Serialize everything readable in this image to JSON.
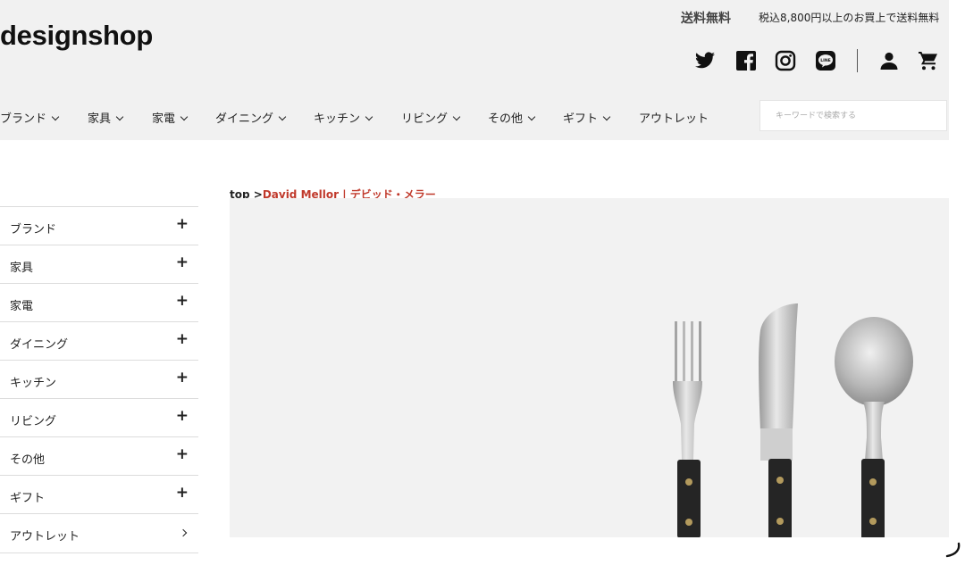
{
  "header": {
    "logo": "designshop",
    "shipping_title": "送料無料",
    "shipping_note": "税込8,800円以上のお買上で送料無料"
  },
  "icons": [
    "twitter-icon",
    "facebook-icon",
    "instagram-icon",
    "line-icon",
    "account-icon",
    "cart-icon"
  ],
  "nav": {
    "items": [
      {
        "label": "ブランド",
        "dropdown": true
      },
      {
        "label": "家具",
        "dropdown": true
      },
      {
        "label": "家電",
        "dropdown": true
      },
      {
        "label": "ダイニング",
        "dropdown": true
      },
      {
        "label": "キッチン",
        "dropdown": true
      },
      {
        "label": "リビング",
        "dropdown": true
      },
      {
        "label": "その他",
        "dropdown": true
      },
      {
        "label": "ギフト",
        "dropdown": true
      },
      {
        "label": "アウトレット",
        "dropdown": false
      }
    ],
    "search_placeholder": "キーワードで検索する"
  },
  "breadcrumb": {
    "home": "top",
    "separator": " >",
    "current": "David Mellor | デビッド・メラー"
  },
  "sidebar": {
    "items": [
      {
        "label": "ブランド",
        "toggle": "+"
      },
      {
        "label": "家具",
        "toggle": "+"
      },
      {
        "label": "家電",
        "toggle": "+"
      },
      {
        "label": "ダイニング",
        "toggle": "+"
      },
      {
        "label": "キッチン",
        "toggle": "+"
      },
      {
        "label": "リビング",
        "toggle": "+"
      },
      {
        "label": "その他",
        "toggle": "+"
      },
      {
        "label": "ギフト",
        "toggle": "+"
      },
      {
        "label": "アウトレット",
        "toggle": "›"
      }
    ]
  },
  "colors": {
    "header_bg": "#f1f1f1",
    "accent_red": "#c0392b",
    "text": "#222222"
  }
}
